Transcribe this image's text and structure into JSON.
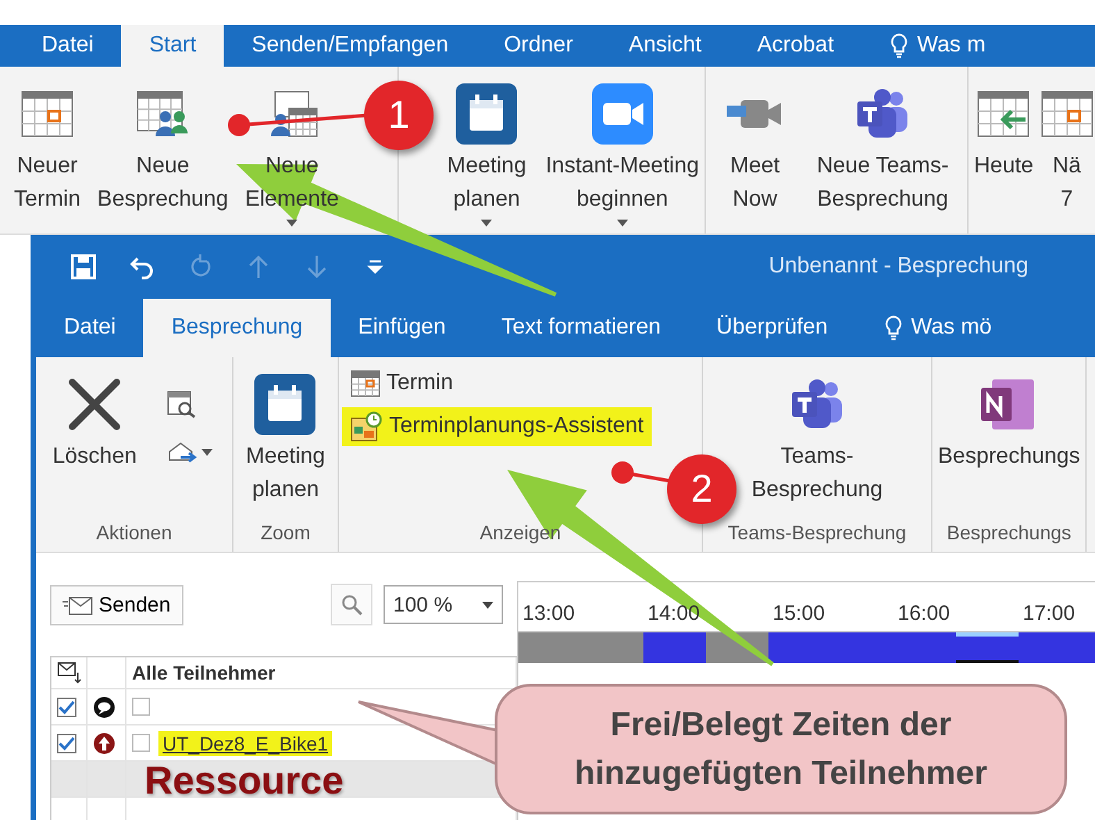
{
  "outer_window": {
    "tabs": [
      {
        "label": "Datei",
        "selected": false
      },
      {
        "label": "Start",
        "selected": true
      },
      {
        "label": "Senden/Empfangen",
        "selected": false
      },
      {
        "label": "Ordner",
        "selected": false
      },
      {
        "label": "Ansicht",
        "selected": false
      },
      {
        "label": "Acrobat",
        "selected": false
      },
      {
        "label": "Was m",
        "kind": "search",
        "selected": false
      }
    ],
    "ribbon": [
      {
        "items": [
          {
            "kind": "large",
            "label": "Neuer\nTermin"
          },
          {
            "kind": "large",
            "label": "Neue\nBesprechung"
          },
          {
            "kind": "large",
            "label": "Neue\nElemente",
            "dropdown": true
          }
        ]
      },
      {
        "items": [
          {
            "kind": "large",
            "label": "Meeting\nplanen",
            "dropdown": true
          },
          {
            "kind": "large",
            "label": "Instant-Meeting\nbeginnen",
            "dropdown": true
          }
        ]
      },
      {
        "items": [
          {
            "kind": "large",
            "label": "Meet\nNow"
          },
          {
            "kind": "large",
            "label": "Neue Teams-\nBesprechung"
          }
        ]
      },
      {
        "items": [
          {
            "kind": "large",
            "label": "Heute"
          },
          {
            "kind": "large",
            "label": "Nä\n7"
          }
        ]
      }
    ]
  },
  "meeting_window": {
    "quick_access": [
      {
        "disabled": false
      },
      {
        "disabled": false
      },
      {
        "disabled": true
      },
      {
        "disabled": true
      },
      {
        "disabled": true
      },
      {
        "disabled": false
      }
    ],
    "title": "Unbenannt - Besprechung",
    "tabs": [
      {
        "label": "Datei",
        "selected": false
      },
      {
        "label": "Besprechung",
        "selected": true
      },
      {
        "label": "Einfügen",
        "selected": false
      },
      {
        "label": "Text formatieren",
        "selected": false
      },
      {
        "label": "Überprüfen",
        "selected": false
      },
      {
        "label": "Was mö",
        "kind": "search",
        "selected": false
      }
    ],
    "ribbon": [
      {
        "label": "Aktionen",
        "items": [
          {
            "kind": "large",
            "label": "Löschen"
          },
          {
            "kind": "tools"
          }
        ]
      },
      {
        "label": "Zoom",
        "items": [
          {
            "kind": "large",
            "label": "Meeting\nplanen"
          }
        ]
      },
      {
        "label": "Anzeigen",
        "items": [
          {
            "kind": "small",
            "label": "Termin",
            "highlighted": false
          },
          {
            "kind": "small",
            "label": "Terminplanungs-Assistent",
            "highlighted": true
          }
        ]
      },
      {
        "label": "Teams-Besprechung",
        "items": [
          {
            "kind": "large",
            "label": "Teams-\nBesprechung"
          }
        ]
      },
      {
        "label": "Besprechungs",
        "items": [
          {
            "kind": "large",
            "label": "Besprechungs"
          }
        ]
      }
    ],
    "scheduling": {
      "send_button": "Senden",
      "zoom": "100 %",
      "hours": [
        "13:00",
        "14:00",
        "15:00",
        "16:00",
        "17:00"
      ],
      "column_header": "Alle Teilnehmer",
      "slots": [
        {
          "busy": false,
          "selected": false
        },
        {
          "busy": false,
          "selected": false
        },
        {
          "busy": false,
          "selected": false
        },
        {
          "busy": false,
          "selected": false
        },
        {
          "busy": true,
          "selected": false
        },
        {
          "busy": true,
          "selected": false
        },
        {
          "busy": false,
          "selected": false
        },
        {
          "busy": false,
          "selected": false
        },
        {
          "busy": true,
          "selected": false
        },
        {
          "busy": true,
          "selected": false
        },
        {
          "busy": true,
          "selected": false
        },
        {
          "busy": true,
          "selected": false
        },
        {
          "busy": true,
          "selected": false
        },
        {
          "busy": true,
          "selected": false
        },
        {
          "busy": true,
          "selected": true
        },
        {
          "busy": true,
          "selected": true
        },
        {
          "busy": true,
          "selected": false
        },
        {
          "busy": true,
          "selected": false
        },
        {
          "busy": true,
          "selected": false
        }
      ],
      "attendees": [
        {
          "checked": true,
          "kind": "organizer",
          "marked": false
        },
        {
          "checked": true,
          "kind": "resource",
          "marked": false,
          "name": "UT_Dez8_E_Bike1",
          "highlighted": true
        },
        {
          "kind": "empty"
        },
        {
          "kind": "blank"
        }
      ]
    }
  },
  "annotations": {
    "badges": [
      "1",
      "2"
    ],
    "callout": "Frei/Belegt Zeiten der hinzugefügten Teilnehmer",
    "label": "Ressource"
  }
}
